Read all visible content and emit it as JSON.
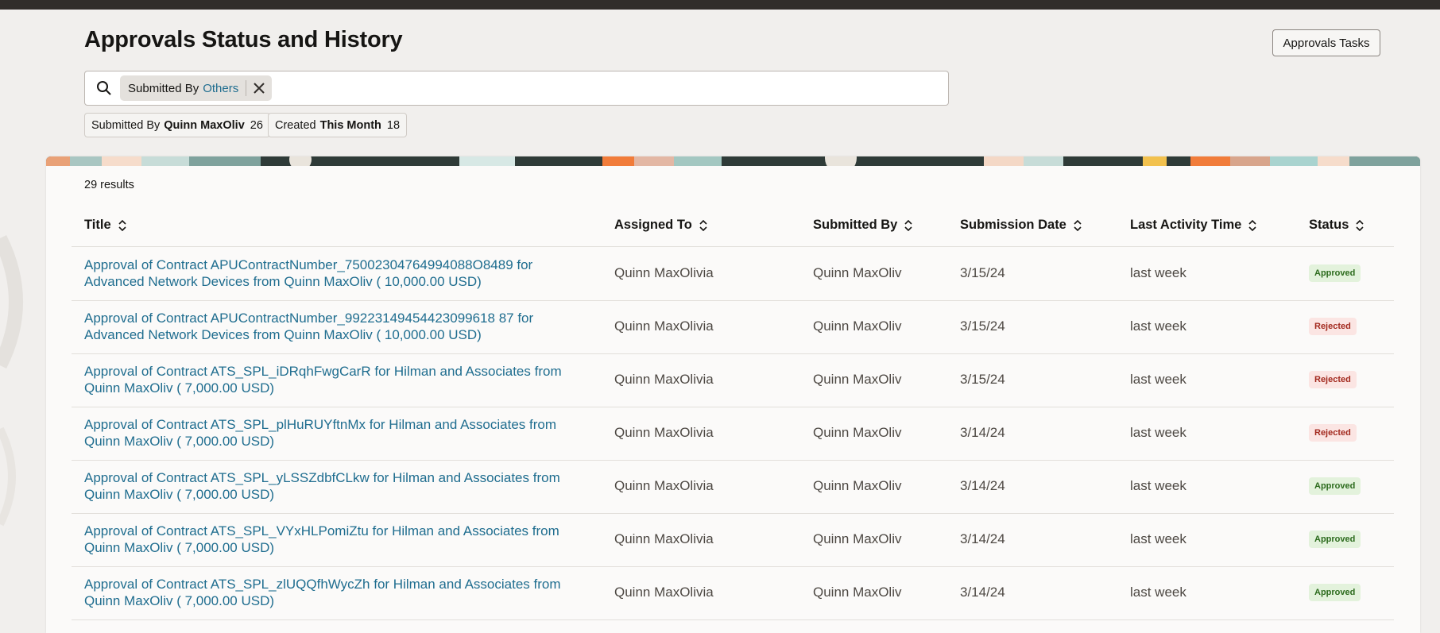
{
  "page": {
    "title": "Approvals Status and History",
    "tasks_button": "Approvals Tasks"
  },
  "search": {
    "chip_label": "Submitted By",
    "chip_value": "Others",
    "placeholder": ""
  },
  "facets": [
    {
      "label": "Submitted By",
      "value": "Quinn MaxOliv",
      "count": "26"
    },
    {
      "label": "Created",
      "value": "This Month",
      "count": "18"
    }
  ],
  "results_count": "29 results",
  "columns": [
    "Title",
    "Assigned To",
    "Submitted By",
    "Submission Date",
    "Last Activity Time",
    "Status"
  ],
  "rows": [
    {
      "title": "Approval of Contract APUContractNumber_75002304764994088O8489 for Advanced Network Devices from Quinn MaxOliv ( 10,000.00 USD)",
      "assigned_to": "Quinn MaxOlivia",
      "submitted_by": "Quinn MaxOliv",
      "date": "3/15/24",
      "last_activity": "last week",
      "status": "Approved"
    },
    {
      "title": "Approval of Contract APUContractNumber_99223149454423099618 87 for Advanced Network Devices from Quinn MaxOliv ( 10,000.00 USD)",
      "assigned_to": "Quinn MaxOlivia",
      "submitted_by": "Quinn MaxOliv",
      "date": "3/15/24",
      "last_activity": "last week",
      "status": "Rejected"
    },
    {
      "title": "Approval of Contract ATS_SPL_iDRqhFwgCarR for Hilman and Associates from Quinn MaxOliv ( 7,000.00 USD)",
      "assigned_to": "Quinn MaxOlivia",
      "submitted_by": "Quinn MaxOliv",
      "date": "3/15/24",
      "last_activity": "last week",
      "status": "Rejected"
    },
    {
      "title": "Approval of Contract ATS_SPL_plHuRUYftnMx for Hilman and Associates from Quinn MaxOliv ( 7,000.00 USD)",
      "assigned_to": "Quinn MaxOlivia",
      "submitted_by": "Quinn MaxOliv",
      "date": "3/14/24",
      "last_activity": "last week",
      "status": "Rejected"
    },
    {
      "title": "Approval of Contract ATS_SPL_yLSSZdbfCLkw for Hilman and Associates from Quinn MaxOliv ( 7,000.00 USD)",
      "assigned_to": "Quinn MaxOlivia",
      "submitted_by": "Quinn MaxOliv",
      "date": "3/14/24",
      "last_activity": "last week",
      "status": "Approved"
    },
    {
      "title": "Approval of Contract ATS_SPL_VYxHLPomiZtu for Hilman and Associates from Quinn MaxOliv ( 7,000.00 USD)",
      "assigned_to": "Quinn MaxOlivia",
      "submitted_by": "Quinn MaxOliv",
      "date": "3/14/24",
      "last_activity": "last week",
      "status": "Approved"
    },
    {
      "title": "Approval of Contract ATS_SPL_zlUQQfhWycZh for Hilman and Associates from Quinn MaxOliv ( 7,000.00 USD)",
      "assigned_to": "Quinn MaxOlivia",
      "submitted_by": "Quinn MaxOliv",
      "date": "3/14/24",
      "last_activity": "last week",
      "status": "Approved"
    }
  ],
  "colors": {
    "link": "#1f6d8f",
    "approved_bg": "#e3f2dc",
    "approved_text": "#2c6b1d",
    "rejected_bg": "#fbe5e3",
    "rejected_text": "#a32a1f"
  }
}
